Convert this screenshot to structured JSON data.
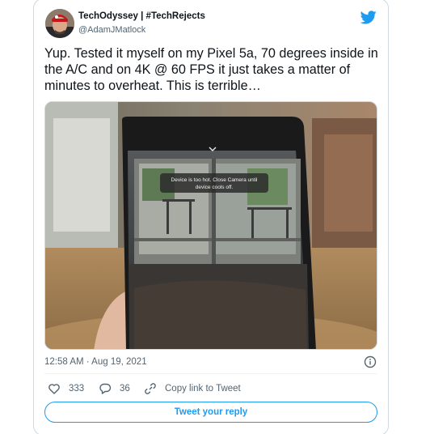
{
  "author": {
    "display_name": "TechOdyssey | #TechRejects",
    "handle": "@AdamJMatlock"
  },
  "tweet": {
    "text": "Yup. Tested it myself on my Pixel 5a, 70 degrees inside in the A/C and on 4K @ 60 FPS it just takes a matter of minutes to overheat. This is terrible…",
    "timestamp": "12:58 AM · Aug 19, 2021"
  },
  "media": {
    "overlay_text": "Device is too hot. Close Camera until device cools off."
  },
  "actions": {
    "likes": "333",
    "replies": "36",
    "copy_link_label": "Copy link to Tweet"
  },
  "reply_button_label": "Tweet your reply",
  "colors": {
    "accent": "#1d9bf0",
    "like_heart": "#536471",
    "text_primary": "#0f1419",
    "text_secondary": "#536471",
    "border": "#cfd9de"
  },
  "icons": [
    "avatar",
    "twitter-bird-icon",
    "info-icon",
    "heart-icon",
    "reply-icon",
    "link-icon"
  ]
}
